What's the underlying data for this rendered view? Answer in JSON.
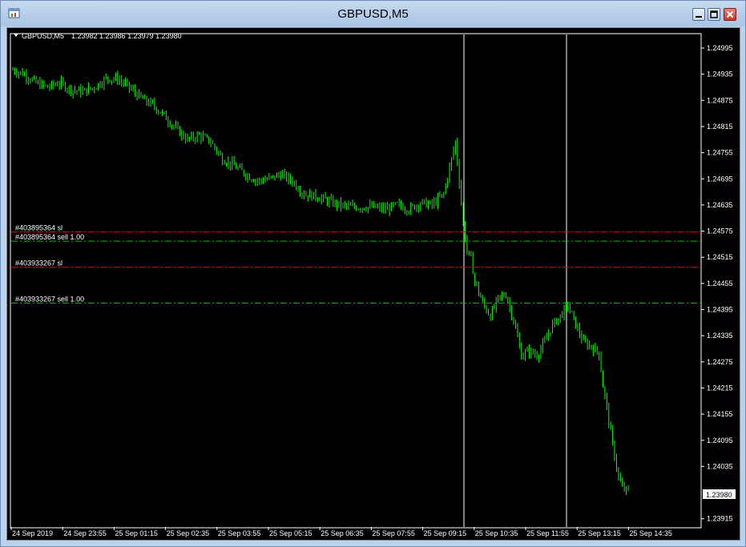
{
  "window": {
    "title": "GBPUSD,M5",
    "icons": {
      "app": "chart-window-icon",
      "minimize": "minimize-icon",
      "maximize": "maximize-icon",
      "close": "close-icon"
    }
  },
  "header": {
    "symbol": "GBPUSD,M5",
    "ohlc": "1.23982 1.23986 1.23979 1.23980",
    "menu_icon": "triangle-down-icon"
  },
  "colors": {
    "background": "#000000",
    "candles": "#00ff00",
    "axis": "#ffffff",
    "sl_line": "#ff0000",
    "order_line": "#00c000",
    "vline": "#ffffff"
  },
  "price_axis": {
    "labels": [
      "1.24995",
      "1.24935",
      "1.24875",
      "1.24815",
      "1.24755",
      "1.24695",
      "1.24635",
      "1.24575",
      "1.24515",
      "1.24455",
      "1.24395",
      "1.24335",
      "1.24275",
      "1.24215",
      "1.24155",
      "1.24095",
      "1.24035",
      "1.23915"
    ],
    "current_price": "1.23980"
  },
  "time_axis": {
    "labels": [
      "24 Sep 2019",
      "24 Sep 23:55",
      "25 Sep 01:15",
      "25 Sep 02:35",
      "25 Sep 03:55",
      "25 Sep 05:15",
      "25 Sep 06:35",
      "25 Sep 07:55",
      "25 Sep 09:15",
      "25 Sep 10:35",
      "25 Sep 11:55",
      "25 Sep 13:15",
      "25 Sep 14:35"
    ]
  },
  "trade_lines": [
    {
      "label": "#403895364 sl",
      "price": 1.24573,
      "kind": "sl"
    },
    {
      "label": "#403895364 sell 1.00",
      "price": 1.24552,
      "kind": "order"
    },
    {
      "label": "#403933267 sl",
      "price": 1.24492,
      "kind": "sl"
    },
    {
      "label": "#403933267 sell 1.00",
      "price": 1.2441,
      "kind": "order"
    }
  ],
  "chart_data": {
    "type": "candlestick",
    "symbol": "GBPUSD",
    "timeframe": "M5",
    "ylim": [
      1.239,
      1.2504
    ],
    "vertical_lines_at": [
      "25 Sep 09:35",
      "25 Sep 12:00"
    ],
    "close_path": [
      [
        0,
        1.24945
      ],
      [
        6,
        1.24935
      ],
      [
        12,
        1.24915
      ],
      [
        18,
        1.24905
      ],
      [
        24,
        1.24915
      ],
      [
        30,
        1.249
      ],
      [
        36,
        1.24895
      ],
      [
        42,
        1.24905
      ],
      [
        48,
        1.24925
      ],
      [
        54,
        1.24925
      ],
      [
        60,
        1.24905
      ],
      [
        66,
        1.2488
      ],
      [
        72,
        1.24865
      ],
      [
        78,
        1.2484
      ],
      [
        84,
        1.2481
      ],
      [
        90,
        1.24785
      ],
      [
        96,
        1.24795
      ],
      [
        102,
        1.2478
      ],
      [
        108,
        1.2474
      ],
      [
        114,
        1.24725
      ],
      [
        120,
        1.24705
      ],
      [
        126,
        1.2469
      ],
      [
        132,
        1.24695
      ],
      [
        138,
        1.24705
      ],
      [
        144,
        1.2469
      ],
      [
        150,
        1.2466
      ],
      [
        156,
        1.24655
      ],
      [
        162,
        1.24645
      ],
      [
        168,
        1.24635
      ],
      [
        174,
        1.2463
      ],
      [
        180,
        1.2463
      ],
      [
        186,
        1.2463
      ],
      [
        192,
        1.24625
      ],
      [
        198,
        1.24635
      ],
      [
        204,
        1.24625
      ],
      [
        210,
        1.2464
      ],
      [
        216,
        1.24635
      ],
      [
        222,
        1.2466
      ],
      [
        226,
        1.2474
      ],
      [
        228,
        1.2478
      ],
      [
        230,
        1.2469
      ],
      [
        232,
        1.2459
      ],
      [
        234,
        1.2453
      ],
      [
        236,
        1.2451
      ],
      [
        238,
        1.2446
      ],
      [
        242,
        1.2441
      ],
      [
        246,
        1.2438
      ],
      [
        250,
        1.2442
      ],
      [
        254,
        1.2443
      ],
      [
        258,
        1.2437
      ],
      [
        262,
        1.2429
      ],
      [
        266,
        1.243
      ],
      [
        270,
        1.2429
      ],
      [
        274,
        1.2432
      ],
      [
        278,
        1.2436
      ],
      [
        282,
        1.2438
      ],
      [
        286,
        1.24405
      ],
      [
        290,
        1.2436
      ],
      [
        294,
        1.2432
      ],
      [
        298,
        1.2431
      ],
      [
        302,
        1.24295
      ],
      [
        304,
        1.2422
      ],
      [
        306,
        1.2417
      ],
      [
        308,
        1.2411
      ],
      [
        310,
        1.2406
      ],
      [
        312,
        1.2401
      ],
      [
        314,
        1.23985
      ],
      [
        316,
        1.2398
      ]
    ]
  }
}
